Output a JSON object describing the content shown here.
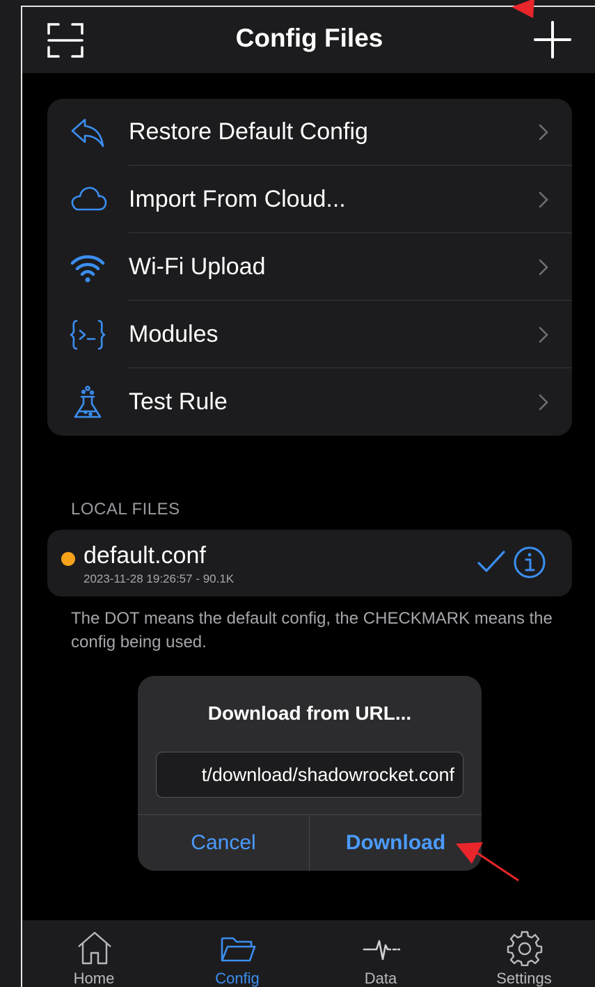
{
  "navbar": {
    "title": "Config Files",
    "left_icon": "scan-qr-icon",
    "right_icon": "plus-icon"
  },
  "menu": {
    "items": [
      {
        "label": "Restore Default Config",
        "icon": "undo-arrow-icon"
      },
      {
        "label": "Import From Cloud...",
        "icon": "cloud-icon"
      },
      {
        "label": "Wi-Fi Upload",
        "icon": "wifi-icon"
      },
      {
        "label": "Modules",
        "icon": "modules-braces-icon"
      },
      {
        "label": "Test Rule",
        "icon": "flask-icon"
      }
    ]
  },
  "local_files": {
    "header": "LOCAL FILES",
    "files": [
      {
        "name": "default.conf",
        "meta": "2023-11-28 19:26:57 - 90.1K",
        "is_default": true,
        "in_use": true
      }
    ],
    "footnote": "The DOT means the default config, the CHECKMARK means the config being used."
  },
  "dialog": {
    "title": "Download from URL...",
    "url_value": "t/download/shadowrocket.conf",
    "cancel_label": "Cancel",
    "download_label": "Download"
  },
  "tabbar": {
    "tabs": [
      {
        "label": "Home",
        "icon": "house-icon",
        "active": false
      },
      {
        "label": "Config",
        "icon": "folder-icon",
        "active": true
      },
      {
        "label": "Data",
        "icon": "pulse-icon",
        "active": false
      },
      {
        "label": "Settings",
        "icon": "gear-icon",
        "active": false
      }
    ]
  },
  "colors": {
    "accent": "#3b8ef0",
    "dot": "#f6a21a",
    "annotation_arrow": "#e8262b",
    "background": "#000000",
    "card": "#1c1c1e"
  }
}
